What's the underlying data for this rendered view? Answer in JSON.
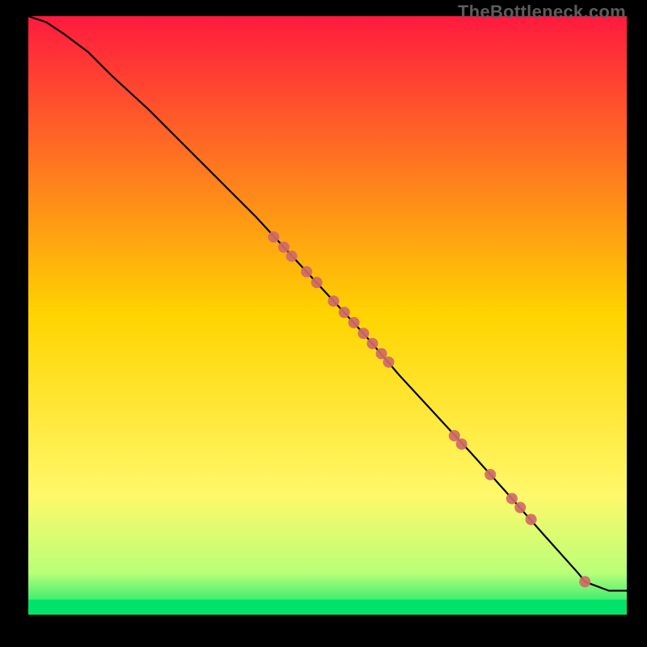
{
  "watermark": "TheBottleneck.com",
  "chart_data": {
    "type": "line",
    "title": "",
    "xlabel": "",
    "ylabel": "",
    "xlim": [
      0,
      100
    ],
    "ylim": [
      0,
      100
    ],
    "grid": false,
    "legend": false,
    "background_gradient": {
      "stops": [
        {
          "pos": 0.0,
          "color": "#ff1a3f"
        },
        {
          "pos": 0.5,
          "color": "#ffd400"
        },
        {
          "pos": 0.8,
          "color": "#fff86a"
        },
        {
          "pos": 0.93,
          "color": "#b9ff78"
        },
        {
          "pos": 1.0,
          "color": "#00e36b"
        }
      ]
    },
    "series": [
      {
        "name": "bottleneck-curve",
        "type": "line",
        "color": "#000000",
        "x": [
          0,
          3,
          6,
          10,
          14,
          20,
          26,
          32,
          38,
          44,
          50,
          56,
          62,
          68,
          74,
          80,
          86,
          92,
          93,
          97,
          100
        ],
        "y": [
          100,
          99,
          97,
          94,
          90,
          84.5,
          78.5,
          72.5,
          66.5,
          60,
          53.5,
          47,
          40,
          33.5,
          27,
          20.3,
          13.5,
          6.8,
          5.5,
          4.0,
          4.0
        ]
      },
      {
        "name": "curve-markers",
        "type": "scatter",
        "color": "#cf6a67",
        "radius_px": 7,
        "x": [
          41,
          42.7,
          44,
          46.5,
          48.2,
          51,
          52.8,
          54.4,
          56,
          57.5,
          59,
          60.2,
          71.2,
          72.4,
          77.2,
          80.8,
          82.2,
          84,
          93
        ],
        "y": [
          63.1,
          61.4,
          59.9,
          57.3,
          55.5,
          52.4,
          50.5,
          48.8,
          47.0,
          45.3,
          43.6,
          42.2,
          29.9,
          28.5,
          23.4,
          19.4,
          17.9,
          15.9,
          5.5
        ]
      }
    ],
    "green_baseline_y": 2.5
  }
}
